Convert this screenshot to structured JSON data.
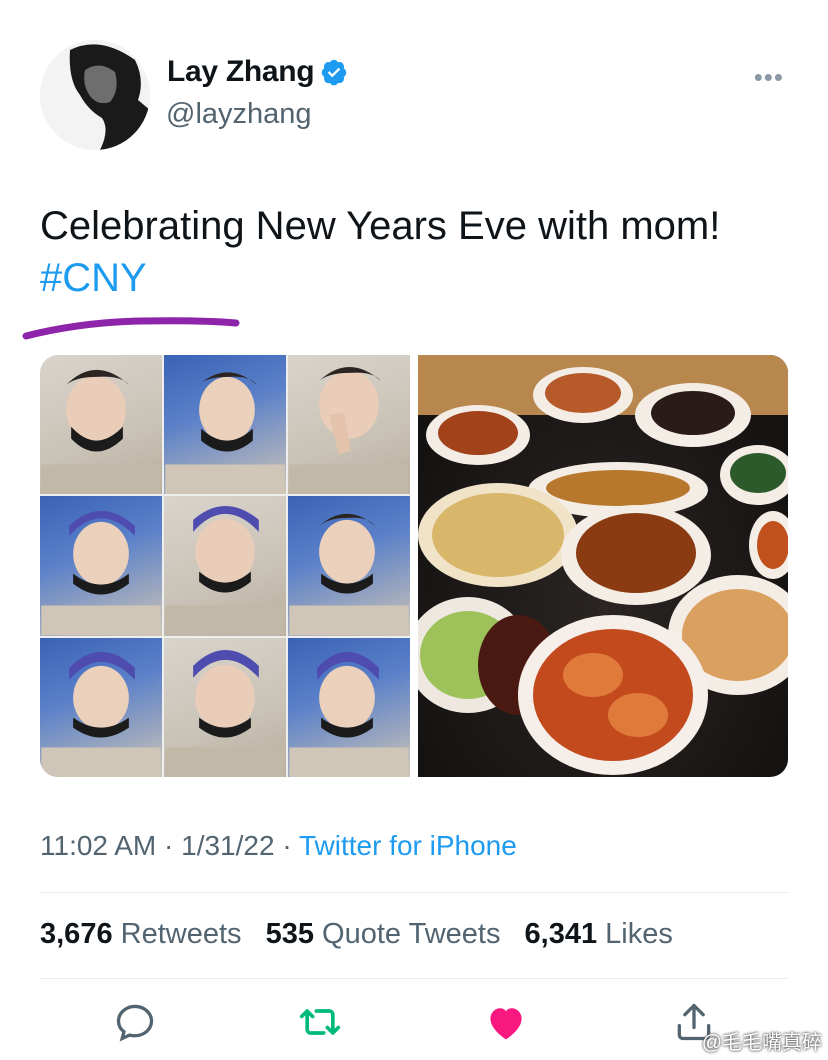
{
  "user": {
    "display_name": "Lay Zhang",
    "handle": "@layzhang",
    "verified": true
  },
  "menu_icon": "more-dots-icon",
  "tweet": {
    "text": "Celebrating New Years Eve with mom!",
    "hashtag": "#CNY"
  },
  "media": {
    "left_image": "selfie-collage",
    "right_image": "dinner-table"
  },
  "meta": {
    "time": "11:02 AM",
    "date": "1/31/22",
    "source": "Twitter for iPhone",
    "sep": "·"
  },
  "stats": {
    "retweets_count": "3,676",
    "retweets_label": "Retweets",
    "quotes_count": "535",
    "quotes_label": "Quote Tweets",
    "likes_count": "6,341",
    "likes_label": "Likes"
  },
  "actions": [
    "reply-icon",
    "retweet-icon",
    "like-icon",
    "share-icon"
  ],
  "watermark": "@毛毛嘴真碎",
  "colors": {
    "accent": "#1d9bf0",
    "retweet": "#00ba7c",
    "like": "#f91880",
    "annotation": "#8e24aa"
  }
}
